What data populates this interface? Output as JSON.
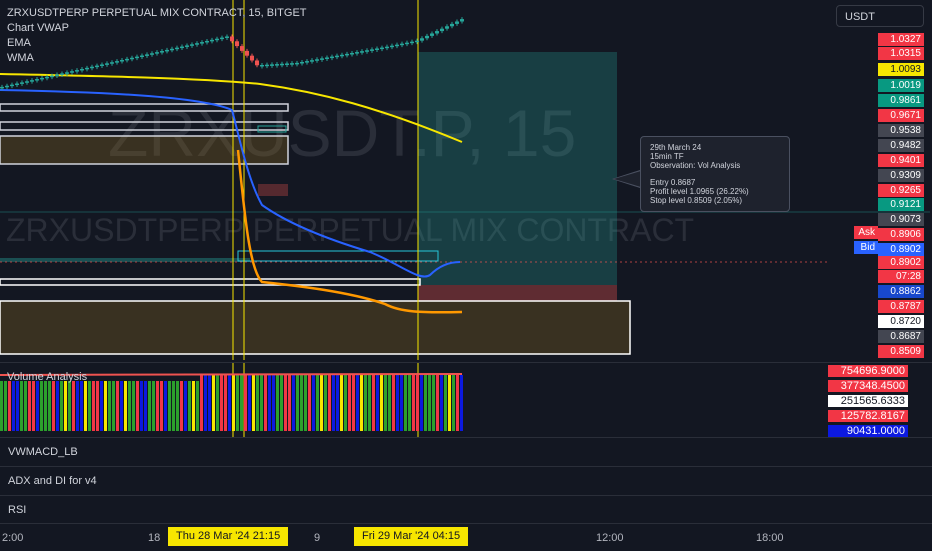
{
  "chart": {
    "symbol_title": "ZRXUSDTPERP PERPETUAL MIX CONTRACT, 15, BITGET",
    "indicators": [
      "Chart VWAP",
      "EMA",
      "WMA"
    ],
    "watermark_ticker": "ZRXUSDT.P, 15",
    "watermark_name": "ZRXUSDTPERP PERPETUAL MIX CONTRACT",
    "currency": "USDT",
    "colors": {
      "background": "#131722",
      "up": "#26a69a",
      "down": "#ef5350",
      "vline": "#f7e600",
      "ema": "#2962ff",
      "wma": "#f7e600",
      "vwap": "#ff9800"
    }
  },
  "price_axis": [
    {
      "label": "1.0327",
      "color": "#f23645"
    },
    {
      "label": "1.0315",
      "color": "#f23645"
    },
    {
      "label": "1.0093",
      "color": "#f7e600"
    },
    {
      "label": "1.0019",
      "color": "#089981"
    },
    {
      "label": "0.9861",
      "color": "#089981"
    },
    {
      "label": "0.9671",
      "color": "#f23645"
    },
    {
      "label": "0.9538",
      "color": "#434651"
    },
    {
      "label": "0.9482",
      "color": "#434651"
    },
    {
      "label": "0.9401",
      "color": "#f23645"
    },
    {
      "label": "0.9309",
      "color": "#434651"
    },
    {
      "label": "0.9265",
      "color": "#f23645"
    },
    {
      "label": "0.9121",
      "color": "#089981"
    },
    {
      "label": "0.9073",
      "color": "#434651"
    },
    {
      "label": "0.8906",
      "color": "#f23645"
    },
    {
      "label": "0.8902",
      "color": "#2962ff"
    },
    {
      "label": "0.8902",
      "color": "#f23645"
    },
    {
      "label": "07:28",
      "color": "#f23645"
    },
    {
      "label": "0.8862",
      "color": "#1848cc"
    },
    {
      "label": "0.8787",
      "color": "#f23645"
    },
    {
      "label": "0.8720",
      "color": "#ffffff"
    },
    {
      "label": "0.8687",
      "color": "#434651"
    },
    {
      "label": "0.8509",
      "color": "#f23645"
    }
  ],
  "ask_bid": {
    "ask": "Ask",
    "bid": "Bid"
  },
  "annotation": {
    "line1": "29th March 24",
    "line2": "15min TF",
    "line3": "Observation: Vol Analysis",
    "line4": "Entry 0.8687",
    "line5": "Profit level 1.0965 (26.22%)",
    "line6": "Stop level 0.8509 (2.05%)"
  },
  "volume_pane": {
    "title": "Volume Analysis",
    "levels": [
      {
        "label": "754696.9000",
        "bg": "#f23645",
        "fg": "#ffffff"
      },
      {
        "label": "377348.4500",
        "bg": "#f23645",
        "fg": "#ffffff"
      },
      {
        "label": "251565.6333",
        "bg": "#ffffff",
        "fg": "#131722"
      },
      {
        "label": "125782.8167",
        "bg": "#f23645",
        "fg": "#ffffff"
      },
      {
        "label": "90431.0000",
        "bg": "#0c19e0",
        "fg": "#ffffff"
      }
    ]
  },
  "sub_panes": [
    "VWMACD_LB",
    "ADX and DI for v4",
    "RSI"
  ],
  "time_axis": {
    "labels": [
      "2:00",
      "18",
      "9",
      "12:00",
      "18:00"
    ],
    "tag1": "Thu 28 Mar '24   21:15",
    "tag2": "Fri 29 Mar '24   04:15"
  }
}
